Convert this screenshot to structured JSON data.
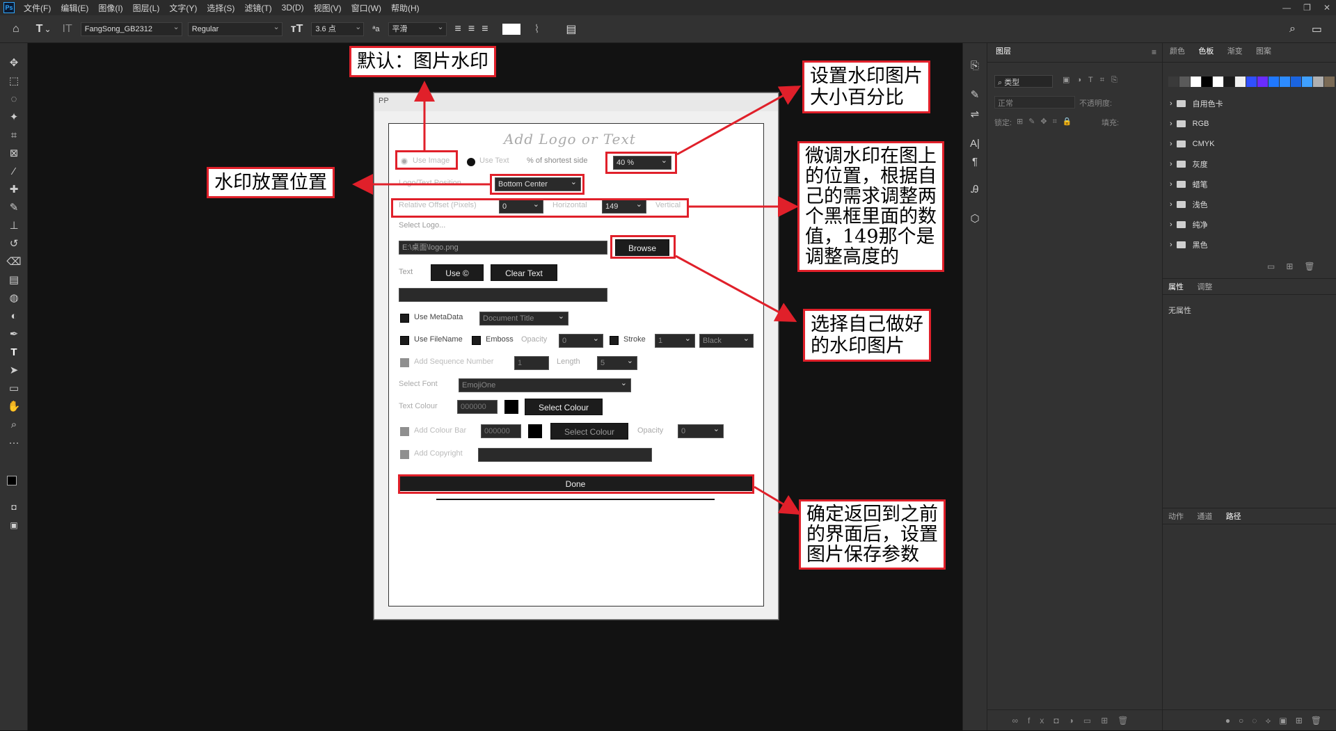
{
  "menubar": {
    "logo": "Ps",
    "items": [
      "文件(F)",
      "编辑(E)",
      "图像(I)",
      "图层(L)",
      "文字(Y)",
      "选择(S)",
      "滤镜(T)",
      "3D(D)",
      "视图(V)",
      "窗口(W)",
      "帮助(H)"
    ],
    "window_controls": [
      "—",
      "❐",
      "✕"
    ]
  },
  "options": {
    "font_family": "FangSong_GB2312",
    "font_style": "Regular",
    "font_size": "3.6 点",
    "aa_label": "ªa",
    "antialias": "平滑"
  },
  "panels": {
    "layers_tab": "图层",
    "layers_filter": "类型",
    "blend_mode": "正常",
    "opacity_label": "不透明度:",
    "lock_label": "锁定:",
    "fill_label": "填充:",
    "swatch_tabs": [
      "颜色",
      "色板",
      "渐变",
      "图案"
    ],
    "swatch_colors": [
      "#3a3a3a",
      "#5a5a5a",
      "#ffffff",
      "#000000",
      "#ffffff",
      "#1a1a1a",
      "#f0f0f0",
      "#3050ff",
      "#6a2cff",
      "#1f78ff",
      "#2d8cff",
      "#1a64e0",
      "#3fa0ff",
      "#b0b0b0",
      "#7a6a55"
    ],
    "swatch_folders": [
      "自用色卡",
      "RGB",
      "CMYK",
      "灰度",
      "蜡笔",
      "浅色",
      "纯净",
      "黑色"
    ],
    "props_tabs": [
      "属性",
      "调整"
    ],
    "props_empty": "无属性",
    "bottom_tabs": [
      "动作",
      "通道",
      "路径"
    ]
  },
  "dialog": {
    "title": "PP",
    "heading": "Add Logo or Text",
    "use_image": "Use Image",
    "use_text": "Use Text",
    "shortest_side_label": "% of shortest side",
    "size_percent": "40 %",
    "logo_position_label": "Logo/Text Position",
    "position": "Bottom Center",
    "relative_offset_label": "Relative Offset (Pixels)",
    "offset_x": "0",
    "horizontal_label": "Horizontal",
    "offset_y": "149",
    "vertical_label": "Vertical",
    "select_logo_label": "Select Logo...",
    "logo_path": "E:\\桌面\\logo.png",
    "browse": "Browse",
    "text_label": "Text",
    "use_copyright": "Use ©",
    "clear_text": "Clear Text",
    "text_value": "",
    "use_metadata": "Use MetaData",
    "metadata_select": "Document Title",
    "use_filename": "Use FileName",
    "emboss": "Emboss",
    "opacity_label": "Opacity",
    "emboss_opacity": "0",
    "stroke": "Stroke",
    "stroke_width": "1",
    "stroke_color": "Black",
    "add_sequence": "Add Sequence Number",
    "sequence_start": "1",
    "length_label": "Length",
    "length_value": "5",
    "select_font_label": "Select Font",
    "font": "EmojiOne",
    "text_colour_label": "Text Colour",
    "text_colour_hex": "000000",
    "select_colour": "Select Colour",
    "add_colour_bar": "Add Colour Bar",
    "bar_colour_hex": "000000",
    "select_colour_2": "Select Colour",
    "bar_opacity_label": "Opacity",
    "bar_opacity": "0",
    "add_copyright": "Add Copyright",
    "copyright_value": "",
    "done": "Done"
  },
  "annotations": {
    "default_image_watermark": "默认：图片水印",
    "set_size_percent": "设置水印图片\n大小百分比",
    "placement": "水印放置位置",
    "fine_tune": "微调水印在图上\n的位置，根据自\n己的需求调整两\n个黑框里面的数\n值，149那个是\n调整高度的",
    "choose_image": "选择自己做好\n的水印图片",
    "confirm": "确定返回到之前\n的界面后，设置\n图片保存参数"
  }
}
